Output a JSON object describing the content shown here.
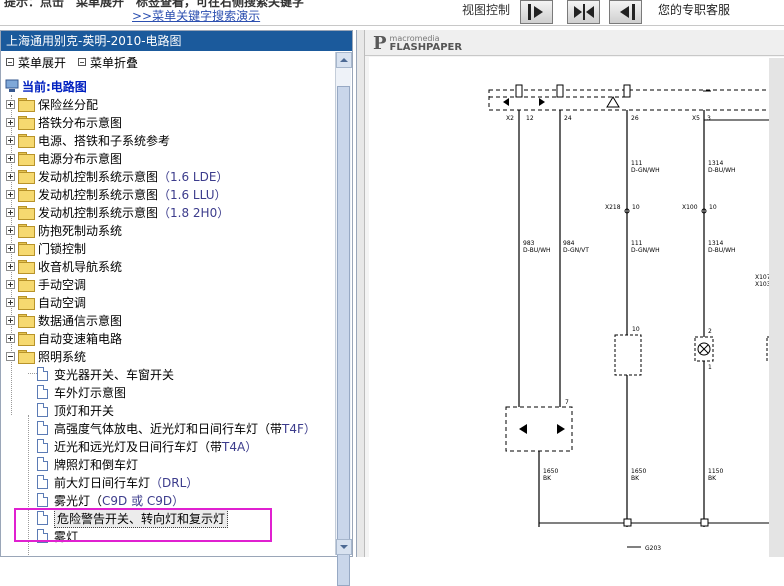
{
  "topbar": {
    "hint_top": "提示：点击＂菜单展开＂标签查看，可在右侧搜索关键字",
    "hint_link": ">>菜单关键字搜索演示",
    "view_control": "视图控制",
    "support": "您的专职客服"
  },
  "left": {
    "doc_title": "上海通用别克-英明-2010-电路图",
    "expand_label": "菜单展开",
    "collapse_label": "菜单折叠",
    "root_label": "当前:电路图",
    "items": [
      {
        "label": "保险丝分配"
      },
      {
        "label": "搭铁分布示意图"
      },
      {
        "label": "电源、搭铁和子系统参考"
      },
      {
        "label": "电源分布示意图"
      },
      {
        "label": "发动机控制系统示意图",
        "suffix": "（1.6 LDE）"
      },
      {
        "label": "发动机控制系统示意图",
        "suffix": "（1.6 LLU）"
      },
      {
        "label": "发动机控制系统示意图",
        "suffix": "（1.8 2H0）"
      },
      {
        "label": "防抱死制动系统"
      },
      {
        "label": "门锁控制"
      },
      {
        "label": "收音机导航系统"
      },
      {
        "label": "手动空调"
      },
      {
        "label": "自动空调"
      },
      {
        "label": "数据通信示意图"
      },
      {
        "label": "自动变速箱电路"
      },
      {
        "label": "照明系统"
      }
    ],
    "sub_items": [
      {
        "label": "变光器开关、车窗开关"
      },
      {
        "label": "车外灯示意图"
      },
      {
        "label": "顶灯和开关"
      },
      {
        "label": "高强度气体放电、近光灯和日间行车灯（带",
        "suffix": "T4F）"
      },
      {
        "label": "近光和远光灯及日间行车灯（带",
        "suffix": "T4A）"
      },
      {
        "label": "牌照灯和倒车灯"
      },
      {
        "label": "前大灯日间行车灯",
        "suffix": "（DRL）"
      },
      {
        "label": "雾光灯（",
        "suffix": "C9D 或 C9D）"
      },
      {
        "label": "危险警告开关、转向灯和复示灯"
      },
      {
        "label": "雾灯"
      }
    ]
  },
  "right": {
    "logo_top": "macromedia",
    "logo_bottom": "FLASHPAPER"
  },
  "diagram": {
    "connectors": [
      "X2",
      "12",
      "24",
      "26",
      "X5",
      "3"
    ],
    "wires": [
      {
        "circuit": "111",
        "color": "D-GN/WH"
      },
      {
        "circuit": "1314",
        "color": "D-BU/WH"
      },
      {
        "circuit": "983",
        "color": "D-BU/WH"
      },
      {
        "circuit": "984",
        "color": "D-GN/VT"
      },
      {
        "circuit": "111",
        "color": "D-GN/WH"
      },
      {
        "circuit": "1314",
        "color": "D-BU/WH"
      },
      {
        "circuit": "1650",
        "color": "BK"
      },
      {
        "circuit": "1650",
        "color": "BK"
      },
      {
        "circuit": "1150",
        "color": "BK"
      },
      {
        "circuit": "1650",
        "color": "BK"
      }
    ],
    "inline": [
      "X218",
      "10",
      "X100",
      "10",
      "X107",
      "X103"
    ],
    "pins": [
      "10",
      "2",
      "1",
      "7",
      "1",
      "1"
    ],
    "ground": "G203"
  }
}
